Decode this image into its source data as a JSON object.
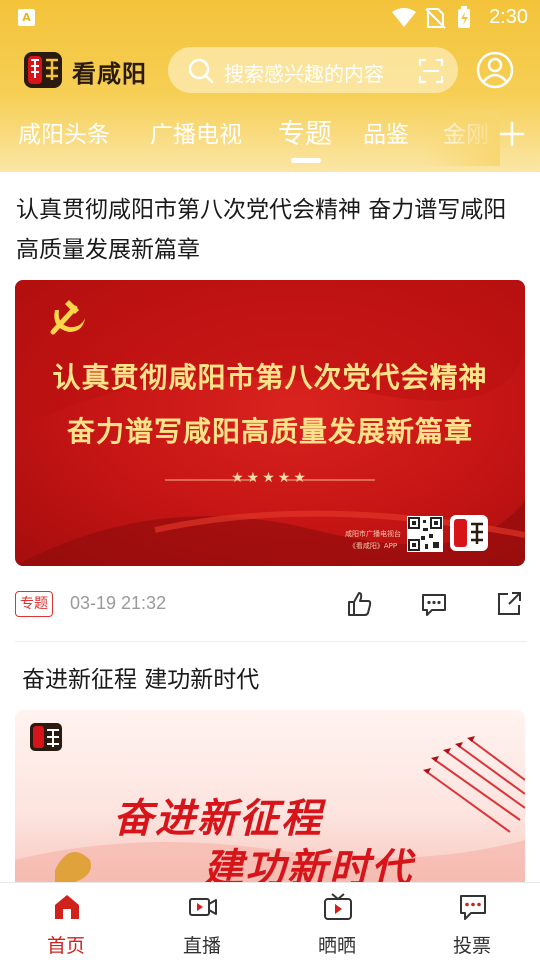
{
  "status_bar": {
    "time": "2:30",
    "app_badge": "A"
  },
  "header": {
    "brand": "看咸阳",
    "search_placeholder": "搜索感兴趣的内容"
  },
  "tabs": [
    "咸阳头条",
    "广播电视",
    "专题",
    "品鉴",
    "金刚"
  ],
  "active_tab": "专题",
  "articles": [
    {
      "title": "认真贯彻咸阳市第八次党代会精神 奋力谱写咸阳高质量发展新篇章",
      "banner_line1": "认真贯彻咸阳市第八次党代会精神",
      "banner_line2": "奋力谱写咸阳高质量发展新篇章",
      "banner_stars": "★★★★★",
      "banner_credit1": "咸阳市广播电视台",
      "banner_credit2": "《看咸阳》APP",
      "tag": "专题",
      "time": "03-19 21:32"
    },
    {
      "title": "奋进新征程 建功新时代",
      "banner_line1": "奋进新征程",
      "banner_line2": "建功新时代"
    }
  ],
  "bottom_nav": [
    {
      "label": "首页",
      "icon": "home-icon"
    },
    {
      "label": "直播",
      "icon": "video-camera-icon"
    },
    {
      "label": "晒晒",
      "icon": "tv-icon"
    },
    {
      "label": "投票",
      "icon": "chat-bubble-icon"
    }
  ],
  "active_nav": "首页",
  "colors": {
    "accent": "#d0211c",
    "header": "#f3c33a",
    "banner_red": "#c41414",
    "banner_gold": "#ffe38a"
  }
}
